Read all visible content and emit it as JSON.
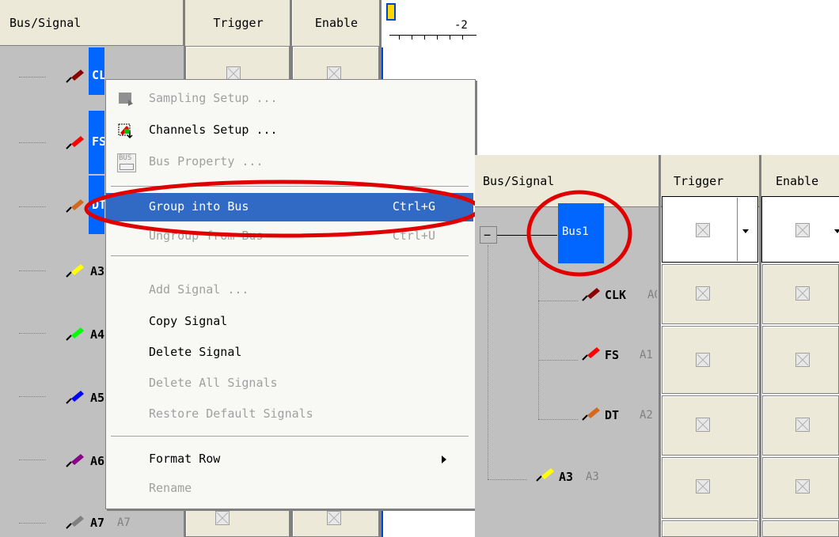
{
  "left_panel": {
    "header": {
      "bus_signal": "Bus/Signal",
      "trigger": "Trigger",
      "enable": "Enable",
      "ruler_value": "-2"
    },
    "signals": [
      {
        "name": "CLK",
        "alias": "A0",
        "color": "#8b0000"
      },
      {
        "name": "FS",
        "alias": "A1",
        "color": "#ff0000"
      },
      {
        "name": "DT",
        "alias": "A2",
        "color": "#d2691e"
      },
      {
        "name": "A3",
        "alias": "A3",
        "color": "#ffff00"
      },
      {
        "name": "A4",
        "alias": "A4",
        "color": "#00ff00"
      },
      {
        "name": "A5",
        "alias": "A5",
        "color": "#0000ff"
      },
      {
        "name": "A6",
        "alias": "A6",
        "color": "#8b008b"
      },
      {
        "name": "A7",
        "alias": "A7",
        "color": "#808080"
      }
    ],
    "selected_labels": [
      "CLK",
      "FS",
      "DT"
    ]
  },
  "context_menu": {
    "items": [
      {
        "label": "Sampling Setup ...",
        "shortcut": "",
        "disabled": true,
        "icon": "sampling-setup-icon"
      },
      {
        "label": "Channels Setup ...",
        "shortcut": "",
        "disabled": false,
        "icon": "channels-setup-icon"
      },
      {
        "label": "Bus Property ...",
        "shortcut": "",
        "disabled": true,
        "icon": "bus-icon",
        "icon_text": "BUS"
      },
      {
        "label": "Group into Bus",
        "shortcut": "Ctrl+G",
        "disabled": false,
        "highlighted": true
      },
      {
        "label": "Ungroup from Bus",
        "shortcut": "Ctrl+U",
        "disabled": true
      },
      {
        "label": "Add Signal ...",
        "shortcut": "",
        "disabled": true
      },
      {
        "label": "Copy Signal",
        "shortcut": "",
        "disabled": false
      },
      {
        "label": "Delete Signal",
        "shortcut": "",
        "disabled": false
      },
      {
        "label": "Delete All Signals",
        "shortcut": "",
        "disabled": true
      },
      {
        "label": "Restore Default Signals",
        "shortcut": "",
        "disabled": true
      },
      {
        "label": "Format Row",
        "shortcut": "",
        "disabled": false,
        "submenu": true
      },
      {
        "label": "Rename",
        "shortcut": "",
        "disabled": true
      }
    ]
  },
  "right_panel": {
    "header": {
      "bus_signal": "Bus/Signal",
      "trigger": "Trigger",
      "enable": "Enable"
    },
    "bus": {
      "name": "Bus1",
      "collapse_symbol": "−"
    },
    "children": [
      {
        "name": "CLK",
        "alias": "A0",
        "color": "#8b0000"
      },
      {
        "name": "FS",
        "alias": "A1",
        "color": "#ff0000"
      },
      {
        "name": "DT",
        "alias": "A2",
        "color": "#d2691e"
      }
    ],
    "after": {
      "name": "A3",
      "alias": "A3",
      "color": "#ffff00"
    }
  },
  "colors": {
    "highlight_blue": "#316ac5",
    "selection_blue": "#0066ff",
    "annotation_red": "#e00000",
    "panel_gray": "#c0c0c0"
  }
}
